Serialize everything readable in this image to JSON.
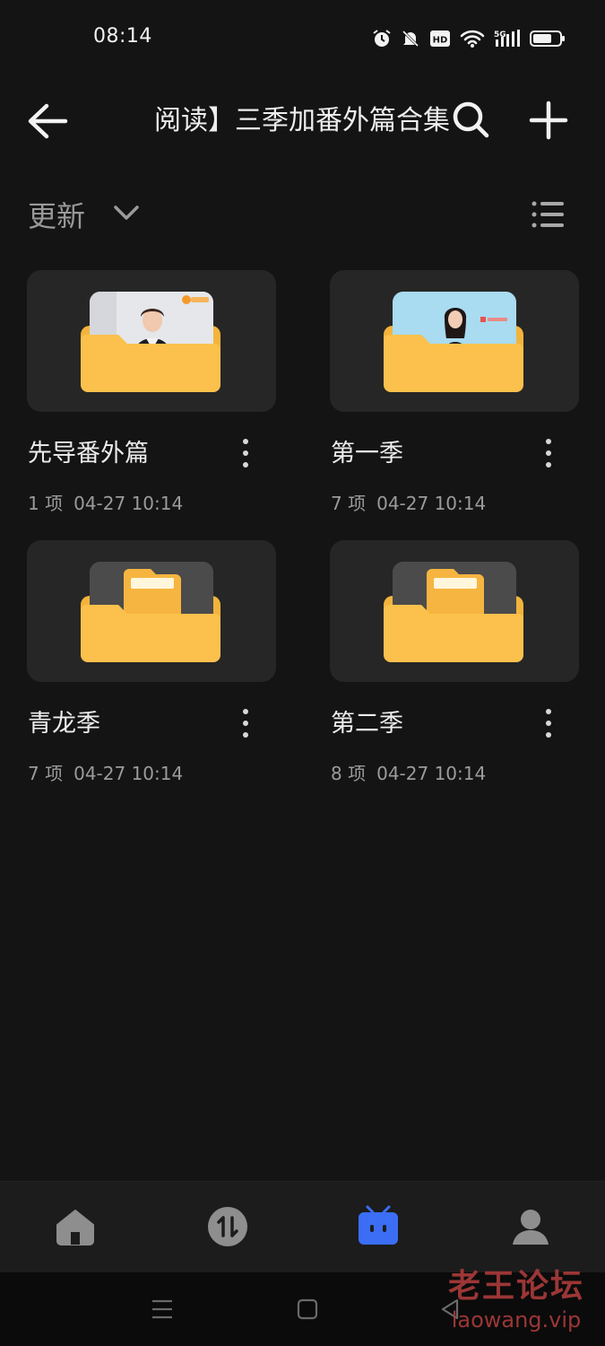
{
  "status_bar": {
    "time": "08:14",
    "icons": [
      "alarm-icon",
      "mute-icon",
      "hd-icon",
      "wifi-icon",
      "5g-signal-icon",
      "battery-icon"
    ],
    "hd_label": "HD",
    "network_label": "5G"
  },
  "header": {
    "title": "阅读】三季加番外篇合集",
    "back_icon": "back-arrow-icon",
    "search_icon": "search-icon",
    "add_icon": "plus-icon"
  },
  "sort_bar": {
    "label": "更新",
    "chevron_icon": "chevron-down-icon",
    "view_icon": "list-view-icon"
  },
  "folders": [
    {
      "name": "先导番外篇",
      "count": "1 项",
      "modified": "04-27 10:14",
      "preview": "video-thumbnail"
    },
    {
      "name": "第一季",
      "count": "7 项",
      "modified": "04-27 10:14",
      "preview": "video-thumbnail"
    },
    {
      "name": "青龙季",
      "count": "7 项",
      "modified": "04-27 10:14",
      "preview": "document"
    },
    {
      "name": "第二季",
      "count": "8 项",
      "modified": "04-27 10:14",
      "preview": "document"
    }
  ],
  "bottom_nav": {
    "items": [
      {
        "id": "home",
        "icon": "home-icon",
        "active": false
      },
      {
        "id": "transfer",
        "icon": "transfer-icon",
        "active": false
      },
      {
        "id": "files",
        "icon": "files-icon",
        "active": true
      },
      {
        "id": "profile",
        "icon": "profile-icon",
        "active": false
      }
    ]
  },
  "system_nav": {
    "items": [
      "menu-icon",
      "home-square-icon",
      "back-triangle-icon"
    ]
  },
  "watermark": {
    "cn": "老王论坛",
    "en": "laowang.vip"
  },
  "colors": {
    "background": "#141414",
    "card": "#262626",
    "folder": "#f3b43c",
    "accent": "#3b6ef5",
    "watermark": "#a83a3a"
  }
}
